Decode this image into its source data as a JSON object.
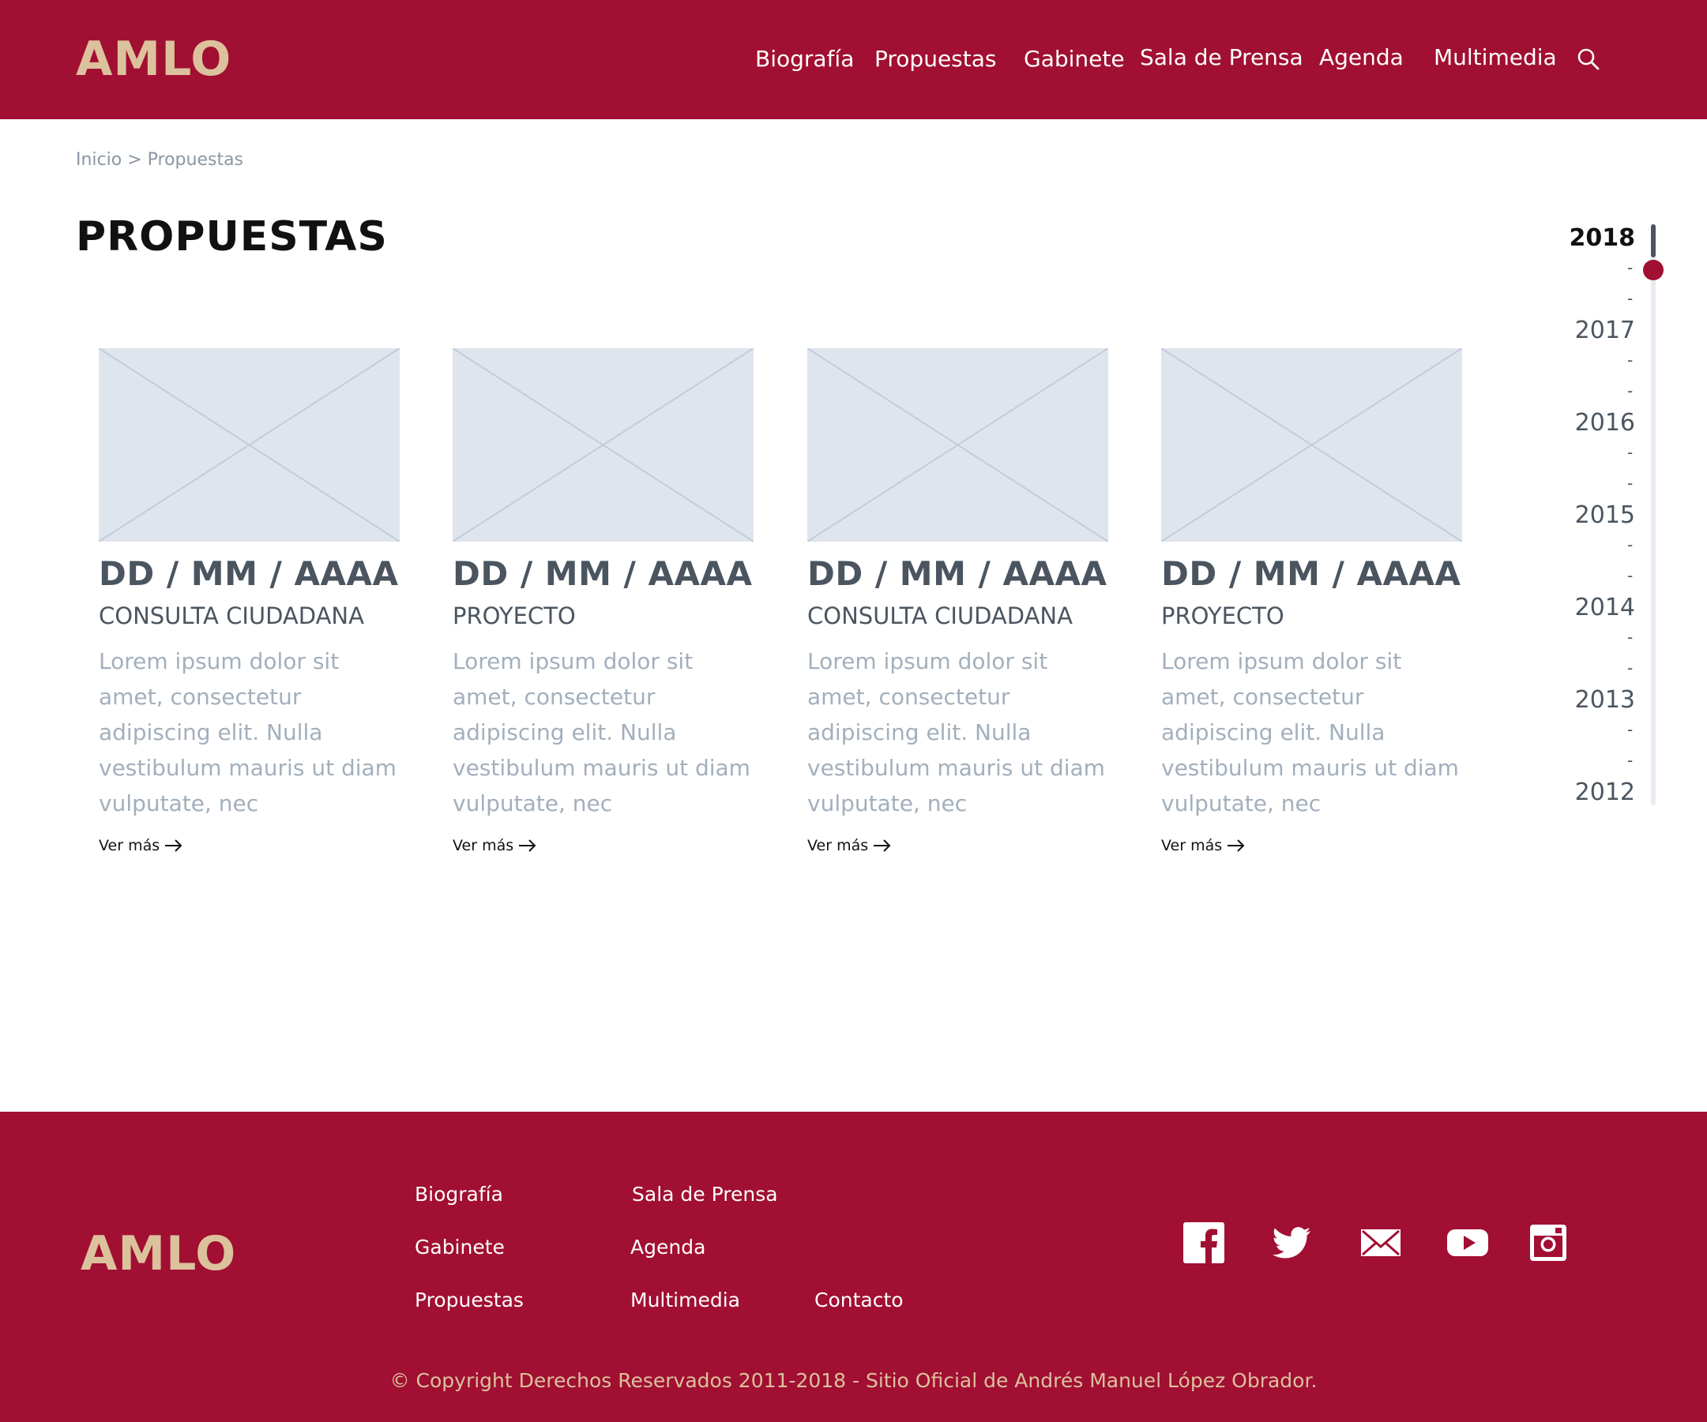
{
  "header": {
    "logo": "AMLO",
    "nav": [
      {
        "label": "Biografía"
      },
      {
        "label": "Propuestas"
      },
      {
        "label": "Gabinete"
      },
      {
        "label": "Sala de Prensa"
      },
      {
        "label": "Agenda"
      },
      {
        "label": "Multimedia"
      }
    ],
    "search_icon": "search-icon"
  },
  "breadcrumb": "Inicio > Propuestas",
  "page_title": "PROPUESTAS",
  "cards": [
    {
      "date": "DD / MM / AAAA",
      "category": "CONSULTA CIUDADANA",
      "description": "Lorem ipsum dolor sit amet, consectetur adipiscing elit. Nulla vestibulum mauris ut diam vulputate, nec",
      "link": "Ver más"
    },
    {
      "date": "DD / MM / AAAA",
      "category": "PROYECTO",
      "description": "Lorem ipsum dolor sit amet, consectetur adipiscing elit. Nulla vestibulum mauris ut diam vulputate, nec",
      "link": "Ver más"
    },
    {
      "date": "DD / MM / AAAA",
      "category": "CONSULTA CIUDADANA",
      "description": "Lorem ipsum dolor sit amet, consectetur adipiscing elit. Nulla vestibulum mauris ut diam vulputate, nec",
      "link": "Ver más"
    },
    {
      "date": "DD / MM / AAAA",
      "category": "PROYECTO",
      "description": "Lorem ipsum dolor sit amet, consectetur adipiscing elit. Nulla vestibulum mauris ut diam vulputate, nec",
      "link": "Ver más"
    }
  ],
  "timeline": {
    "years": [
      "2018",
      "2017",
      "2016",
      "2015",
      "2014",
      "2013",
      "2012"
    ],
    "selected": "2018",
    "separator": "-"
  },
  "footer": {
    "logo": "AMLO",
    "links": [
      {
        "label": "Biografía"
      },
      {
        "label": "Sala de Prensa"
      },
      {
        "label": "Gabinete"
      },
      {
        "label": "Agenda"
      },
      {
        "label": "Propuestas"
      },
      {
        "label": "Multimedia"
      },
      {
        "label": "Contacto"
      }
    ],
    "social_icons": [
      "facebook-icon",
      "twitter-icon",
      "mail-icon",
      "youtube-icon",
      "instagram-icon"
    ],
    "copyright": "© Copyright Derechos Reservados 2011-2018 - Sitio Oficial de Andrés Manuel López Obrador."
  },
  "colors": {
    "brand": "#a10f32",
    "logo": "#dcc19d",
    "placeholder_fill": "#dfe5ee",
    "placeholder_line": "#c4ccd8"
  }
}
